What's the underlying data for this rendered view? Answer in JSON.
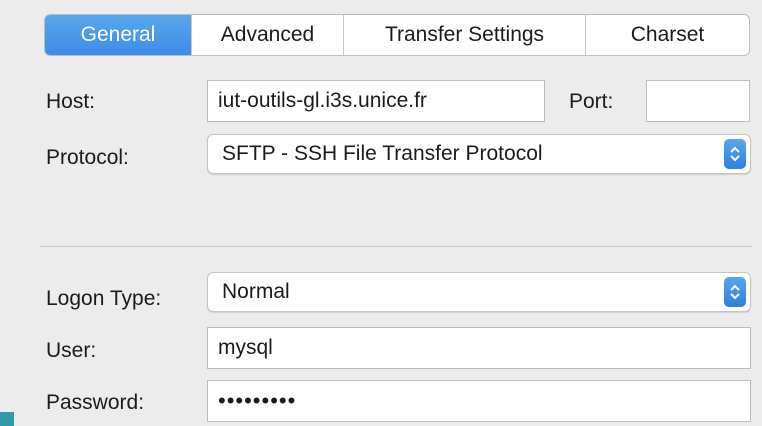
{
  "tabs": [
    {
      "label": "General",
      "active": true
    },
    {
      "label": "Advanced",
      "active": false
    },
    {
      "label": "Transfer Settings",
      "active": false
    },
    {
      "label": "Charset",
      "active": false
    }
  ],
  "host": {
    "label": "Host:",
    "value": "iut-outils-gl.i3s.unice.fr"
  },
  "port": {
    "label": "Port:",
    "value": ""
  },
  "protocol": {
    "label": "Protocol:",
    "selected": "SFTP - SSH File Transfer Protocol"
  },
  "logon_type": {
    "label": "Logon Type:",
    "selected": "Normal"
  },
  "user": {
    "label": "User:",
    "value": "mysql"
  },
  "password": {
    "label": "Password:",
    "value": "•••••••••"
  },
  "colors": {
    "accent": "#3b8de6",
    "panel": "#ececec",
    "teal": "#2f9aa8"
  },
  "icons": {
    "select_stepper": "chevron-up-down-icon"
  }
}
